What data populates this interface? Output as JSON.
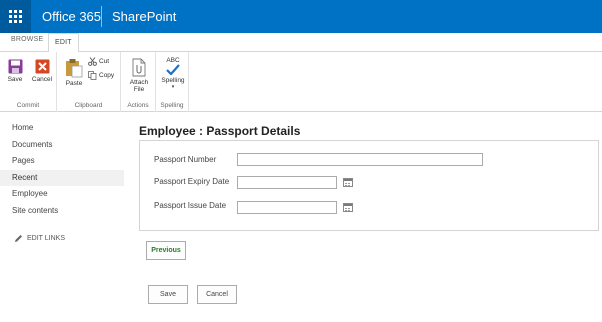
{
  "suite_bar": {
    "product": "Office 365",
    "app": "SharePoint",
    "accent_color": "#0072c6"
  },
  "ribbon": {
    "tabs": [
      {
        "label": "BROWSE",
        "active": false
      },
      {
        "label": "EDIT",
        "active": true
      }
    ],
    "groups": {
      "commit": {
        "label": "Commit",
        "buttons": [
          {
            "label": "Save",
            "icon": "save-icon"
          },
          {
            "label": "Cancel",
            "icon": "cancel-icon"
          }
        ]
      },
      "clipboard": {
        "label": "Clipboard",
        "paste": {
          "label": "Paste",
          "icon": "paste-icon"
        },
        "cut": {
          "label": "Cut",
          "icon": "cut-icon"
        },
        "copy": {
          "label": "Copy",
          "icon": "copy-icon"
        }
      },
      "actions": {
        "label": "Actions",
        "attach_line1": "Attach",
        "attach_line2": "File",
        "icon": "attach-file-icon"
      },
      "spelling": {
        "label": "Spelling",
        "abc": "ABC",
        "button_label": "Spelling",
        "icon": "spelling-check-icon"
      }
    }
  },
  "nav": {
    "items": [
      {
        "label": "Home",
        "selected": false
      },
      {
        "label": "Documents",
        "selected": false
      },
      {
        "label": "Pages",
        "selected": false
      },
      {
        "label": "Recent",
        "selected": true
      },
      {
        "label": "Employee",
        "selected": false
      },
      {
        "label": "Site contents",
        "selected": false
      }
    ],
    "edit_links": "EDIT LINKS"
  },
  "main": {
    "title": "Employee : Passport Details",
    "fields": {
      "passport_number": {
        "label": "Passport Number",
        "value": ""
      },
      "expiry_date": {
        "label": "Passport Expiry Date",
        "value": ""
      },
      "issue_date": {
        "label": "Passport Issue Date",
        "value": ""
      }
    },
    "previous_label": "Previous",
    "save_label": "Save",
    "cancel_label": "Cancel"
  }
}
